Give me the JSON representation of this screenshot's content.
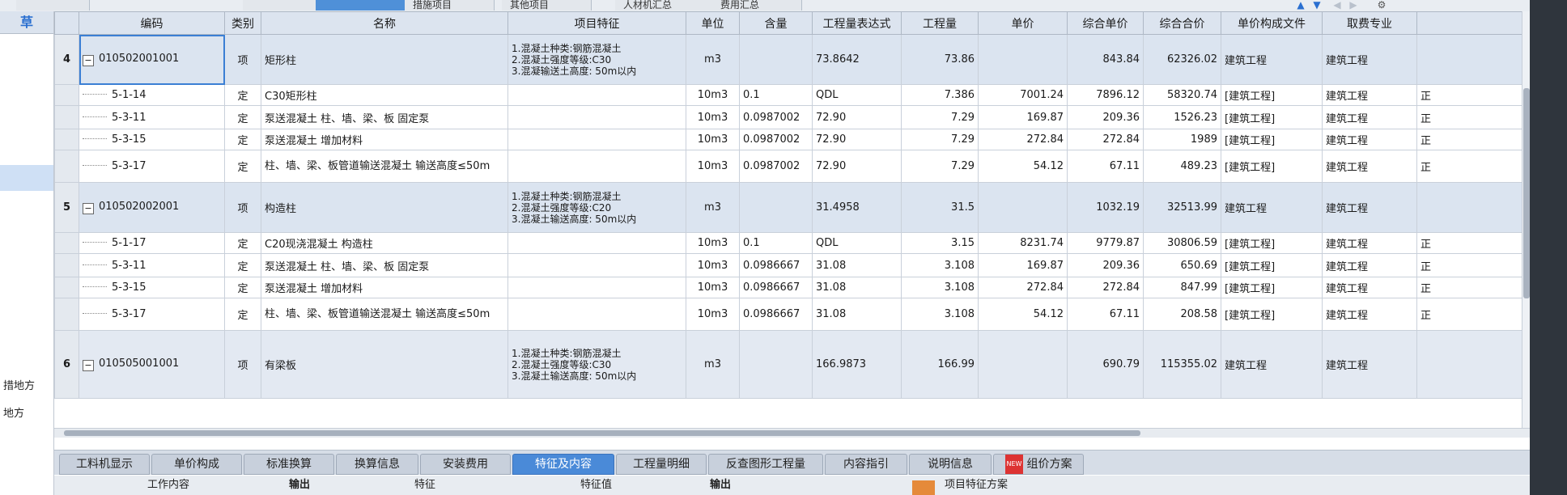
{
  "top_tabs": [
    "措施项目",
    "其他项目",
    "人材机汇总",
    "费用汇总"
  ],
  "left_panel": {
    "header_glyph": "草",
    "texts": [
      "措地方",
      "地方"
    ]
  },
  "columns": [
    "编码",
    "类别",
    "名称",
    "项目特征",
    "单位",
    "含量",
    "工程量表达式",
    "工程量",
    "单价",
    "综合单价",
    "综合合价",
    "单价构成文件",
    "取费专业"
  ],
  "rows": [
    {
      "type": "item",
      "no": "4",
      "code": "010502001001",
      "cat": "项",
      "name": "矩形柱",
      "feature": [
        "1.混凝土种类:钢筋混凝土",
        "2.混凝土强度等级:C30",
        "3.混凝输送土高度: 50m以内"
      ],
      "unit": "m3",
      "qty_ratio": "",
      "expr": "73.8642",
      "qty": "73.86",
      "price": "",
      "unit_total": "843.84",
      "total": "62326.02",
      "file": "建筑工程",
      "major": "建筑工程",
      "extra": ""
    },
    {
      "type": "sub",
      "no": "",
      "code": "5-1-14",
      "cat": "定",
      "name": "C30矩形柱",
      "feature": [],
      "unit": "10m3",
      "qty_ratio": "0.1",
      "expr": "QDL",
      "qty": "7.386",
      "price": "7001.24",
      "unit_total": "7896.12",
      "total": "58320.74",
      "file": "[建筑工程]",
      "major": "建筑工程",
      "extra": "正"
    },
    {
      "type": "sub",
      "no": "",
      "code": "5-3-11",
      "cat": "定",
      "name": "泵送混凝土 柱、墙、梁、板 固定泵",
      "feature": [],
      "unit": "10m3",
      "qty_ratio": "0.0987002",
      "expr": "72.90",
      "qty": "7.29",
      "price": "169.87",
      "unit_total": "209.36",
      "total": "1526.23",
      "file": "[建筑工程]",
      "major": "建筑工程",
      "extra": "正"
    },
    {
      "type": "sub",
      "no": "",
      "code": "5-3-15",
      "cat": "定",
      "name": "泵送混凝土 增加材料",
      "feature": [],
      "unit": "10m3",
      "qty_ratio": "0.0987002",
      "expr": "72.90",
      "qty": "7.29",
      "price": "272.84",
      "unit_total": "272.84",
      "total": "1989",
      "file": "[建筑工程]",
      "major": "建筑工程",
      "extra": "正"
    },
    {
      "type": "sub",
      "no": "",
      "code": "5-3-17",
      "cat": "定",
      "name": "柱、墙、梁、板管道输送混凝土 输送高度≤50m",
      "feature": [],
      "unit": "10m3",
      "qty_ratio": "0.0987002",
      "expr": "72.90",
      "qty": "7.29",
      "price": "54.12",
      "unit_total": "67.11",
      "total": "489.23",
      "file": "[建筑工程]",
      "major": "建筑工程",
      "extra": "正"
    },
    {
      "type": "item",
      "no": "5",
      "code": "010502002001",
      "cat": "项",
      "name": "构造柱",
      "feature": [
        "1.混凝土种类:钢筋混凝土",
        "2.混凝土强度等级:C20",
        "3.混凝土输送高度: 50m以内"
      ],
      "unit": "m3",
      "qty_ratio": "",
      "expr": "31.4958",
      "qty": "31.5",
      "price": "",
      "unit_total": "1032.19",
      "total": "32513.99",
      "file": "建筑工程",
      "major": "建筑工程",
      "extra": ""
    },
    {
      "type": "sub",
      "no": "",
      "code": "5-1-17",
      "cat": "定",
      "name": "C20现浇混凝土 构造柱",
      "feature": [],
      "unit": "10m3",
      "qty_ratio": "0.1",
      "expr": "QDL",
      "qty": "3.15",
      "price": "8231.74",
      "unit_total": "9779.87",
      "total": "30806.59",
      "file": "[建筑工程]",
      "major": "建筑工程",
      "extra": "正"
    },
    {
      "type": "sub",
      "no": "",
      "code": "5-3-11",
      "cat": "定",
      "name": "泵送混凝土 柱、墙、梁、板 固定泵",
      "feature": [],
      "unit": "10m3",
      "qty_ratio": "0.0986667",
      "expr": "31.08",
      "qty": "3.108",
      "price": "169.87",
      "unit_total": "209.36",
      "total": "650.69",
      "file": "[建筑工程]",
      "major": "建筑工程",
      "extra": "正"
    },
    {
      "type": "sub",
      "no": "",
      "code": "5-3-15",
      "cat": "定",
      "name": "泵送混凝土 增加材料",
      "feature": [],
      "unit": "10m3",
      "qty_ratio": "0.0986667",
      "expr": "31.08",
      "qty": "3.108",
      "price": "272.84",
      "unit_total": "272.84",
      "total": "847.99",
      "file": "[建筑工程]",
      "major": "建筑工程",
      "extra": "正"
    },
    {
      "type": "sub",
      "no": "",
      "code": "5-3-17",
      "cat": "定",
      "name": "柱、墙、梁、板管道输送混凝土 输送高度≤50m",
      "feature": [],
      "unit": "10m3",
      "qty_ratio": "0.0986667",
      "expr": "31.08",
      "qty": "3.108",
      "price": "54.12",
      "unit_total": "67.11",
      "total": "208.58",
      "file": "[建筑工程]",
      "major": "建筑工程",
      "extra": "正"
    },
    {
      "type": "item",
      "no": "6",
      "code": "010505001001",
      "cat": "项",
      "name": "有梁板",
      "feature": [
        "1.混凝土种类:钢筋混凝土",
        "2.混凝土强度等级:C30",
        "3.混凝土输送高度: 50m以内"
      ],
      "unit": "m3",
      "qty_ratio": "",
      "expr": "166.9873",
      "qty": "166.99",
      "price": "",
      "unit_total": "690.79",
      "total": "115355.02",
      "file": "建筑工程",
      "major": "建筑工程",
      "extra": ""
    }
  ],
  "bottom_tabs": [
    "工料机显示",
    "单价构成",
    "标准换算",
    "换算信息",
    "安装费用",
    "特征及内容",
    "工程量明细",
    "反查图形工程量",
    "内容指引",
    "说明信息",
    "组价方案"
  ],
  "bottom_active": "特征及内容",
  "new_badge": "NEW",
  "lower_headers": [
    "工作内容",
    "输出",
    "特征",
    "特征值",
    "输出",
    "项目特征方案"
  ],
  "colors": {
    "header_bg": "#dce4ef",
    "item_row": "#dbe4f0",
    "active_tab": "#4a8ad8",
    "accent": "#2a6fd0"
  }
}
